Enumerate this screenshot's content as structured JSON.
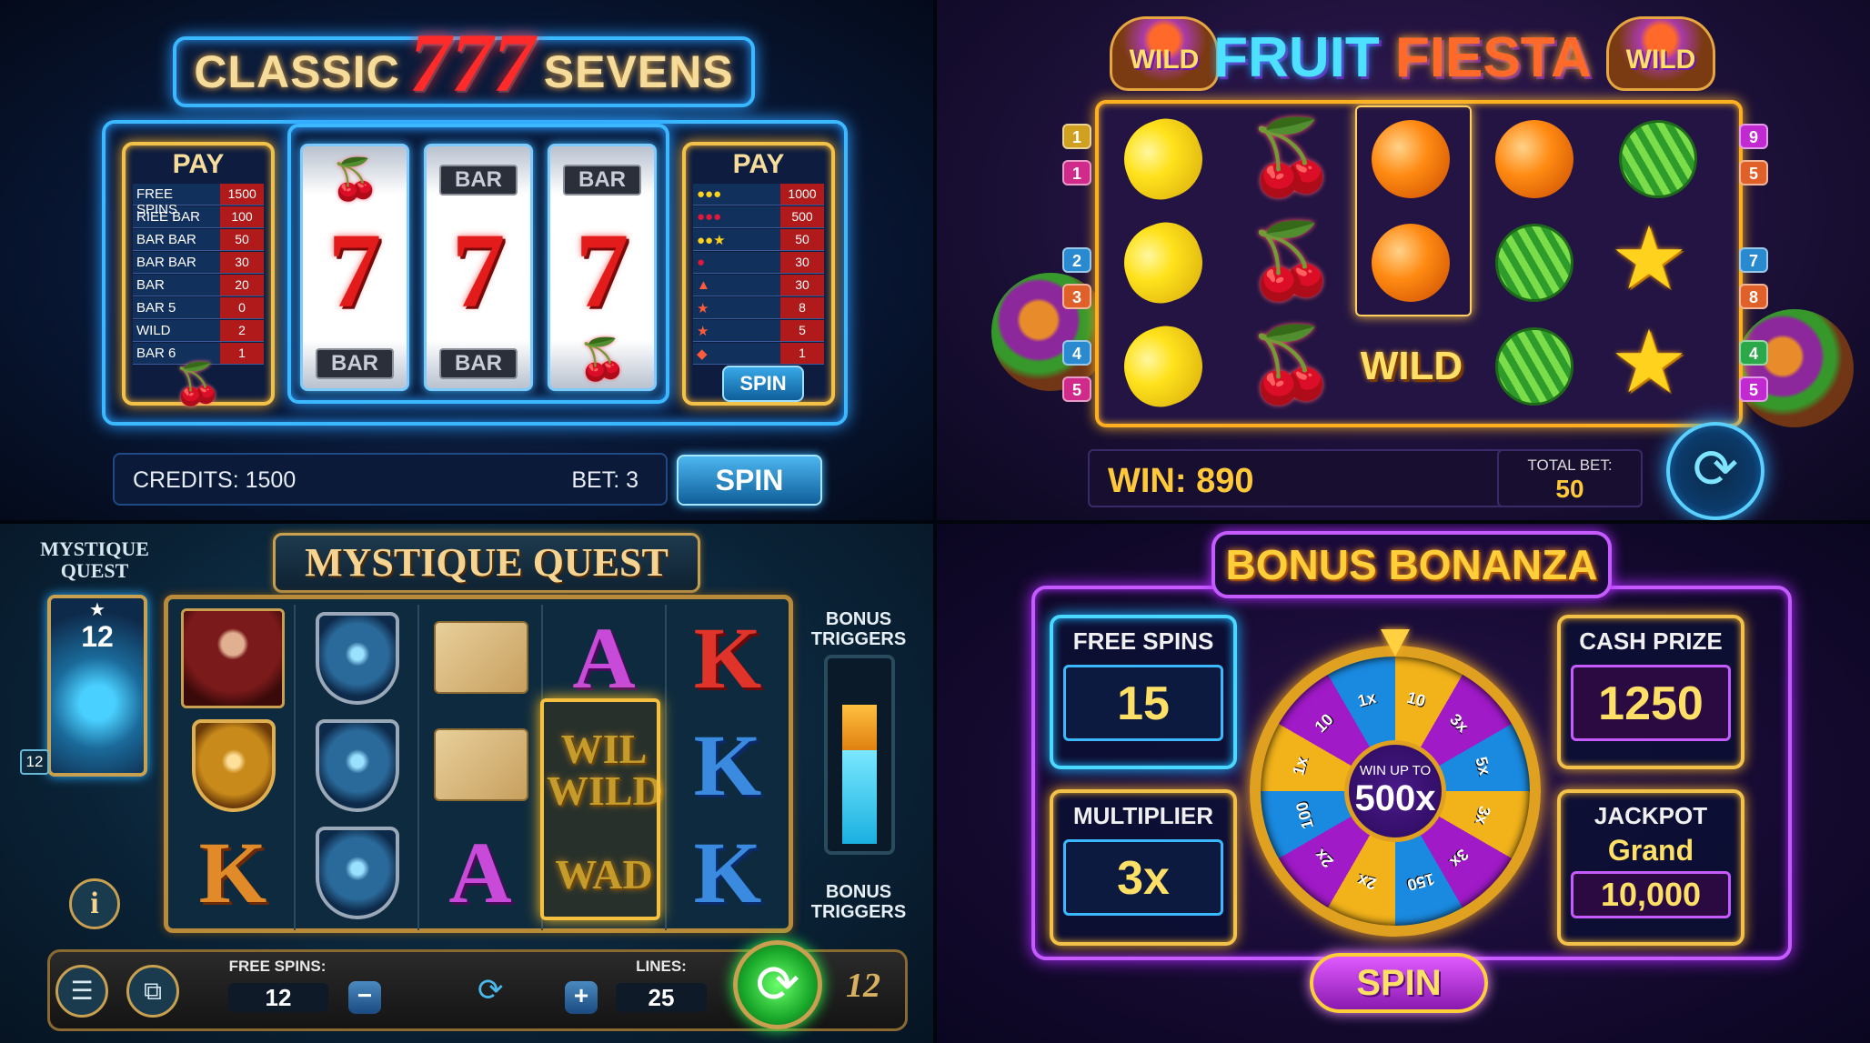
{
  "classic": {
    "title_left": "CLASSIC",
    "title_sevens": "777",
    "title_right": "SEVENS",
    "paytable_left": {
      "title": "PAY",
      "rows": [
        {
          "label": "FREE SPINS",
          "value": "1500"
        },
        {
          "label": "RIEE BAR",
          "value": "100"
        },
        {
          "label": "BAR BAR",
          "value": "50"
        },
        {
          "label": "BAR BAR",
          "value": "30"
        },
        {
          "label": "BAR",
          "value": "20"
        },
        {
          "label": "BAR 5",
          "value": "0"
        },
        {
          "label": "WILD",
          "value": "2"
        },
        {
          "label": "BAR 6",
          "value": "1"
        }
      ]
    },
    "paytable_right": {
      "title": "PAY",
      "rows": [
        "1000",
        "500",
        "50",
        "30",
        "30",
        "8",
        "5",
        "1"
      ],
      "spin_label": "SPIN"
    },
    "reels": {
      "bar_label": "BAR",
      "seven": "7"
    },
    "credits_text": "CREDITS: 1500",
    "bet_text": "BET: 3",
    "spin_label": "SPIN"
  },
  "fruit": {
    "title_a": "FRUIT",
    "title_b": "FIESTA",
    "wild_label": "WILD",
    "grid_wild": "WILD",
    "line_badges_left": [
      "1",
      "1",
      "2",
      "3",
      "4",
      "5"
    ],
    "line_badges_right": [
      "9",
      "5",
      "7",
      "8",
      "4",
      "5"
    ],
    "win_text": "WIN: 890",
    "total_bet_label": "TOTAL BET:",
    "total_bet_value": "50",
    "spin_icon": "refresh-icon"
  },
  "mystique": {
    "title": "MYSTIQUE QUEST",
    "side_title": "MYSTIQUE QUEST",
    "card_value": "12",
    "tag_value": "12",
    "info_glyph": "i",
    "letters": {
      "a": "A",
      "k": "K"
    },
    "wild_lines": [
      "WIL",
      "WILD",
      "WAD"
    ],
    "bonus_triggers": "BONUS TRIGGERS",
    "free_spins_label": "FREE SPINS:",
    "free_spins_value": "12",
    "lines_label": "LINES:",
    "lines_value": "25",
    "minus": "−",
    "plus": "+",
    "corner_badge": "12",
    "meter_fill": 0.78
  },
  "bonanza": {
    "title": "BONUS BONANZA",
    "free_spins_label": "FREE SPINS",
    "free_spins_value": "15",
    "multiplier_label": "MULTIPLIER",
    "multiplier_value": "3x",
    "cash_prize_label": "CASH PRIZE",
    "cash_prize_value": "1250",
    "jackpot_label": "JACKPOT",
    "jackpot_tier": "Grand",
    "jackpot_value": "10,000",
    "hub_line1": "WIN UP TO",
    "hub_line2": "500x",
    "wheel_segments": [
      "10",
      "3x",
      "5x",
      "3x",
      "3x",
      "150",
      "2x",
      "2x",
      "100",
      "1x",
      "10",
      "1x"
    ],
    "spin_label": "SPIN"
  },
  "colors": {
    "neon_blue": "#3bb8ff",
    "neon_purple": "#c55bff",
    "gold": "#f2c14a",
    "red_seven": "#e31b1b"
  }
}
